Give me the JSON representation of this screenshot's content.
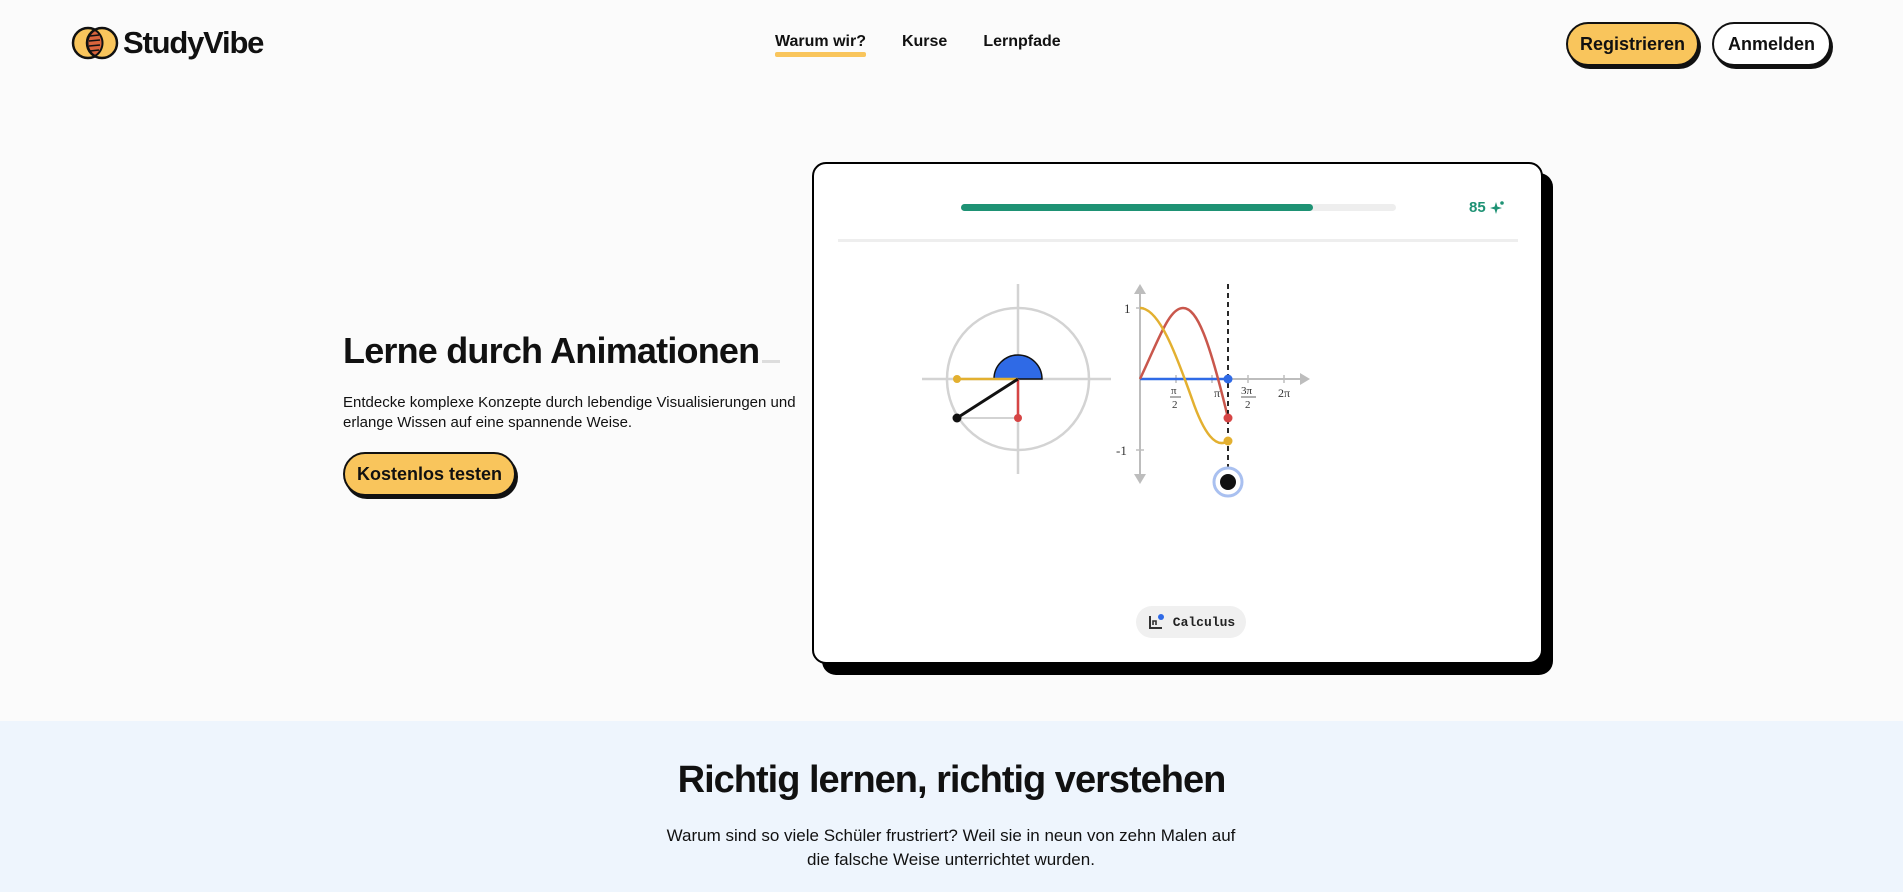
{
  "brand": {
    "name": "StudyVibe"
  },
  "nav": {
    "items": [
      {
        "label": "Warum wir?",
        "active": true
      },
      {
        "label": "Kurse",
        "active": false
      },
      {
        "label": "Lernpfade",
        "active": false
      }
    ]
  },
  "auth": {
    "register_label": "Registrieren",
    "login_label": "Anmelden"
  },
  "hero": {
    "title": "Lerne durch Animationen",
    "subtitle": "Entdecke komplexe Konzepte durch lebendige Visualisierungen und erlange Wissen auf eine spannende Weise.",
    "cta_label": "Kostenlos testen"
  },
  "demo": {
    "progress_percent": 81,
    "score": "85",
    "score_icon": "sparkle-icon",
    "axis_labels": {
      "y_top": "1",
      "y_bottom": "-1",
      "x_half_pi_num": "π",
      "x_half_pi_den": "2",
      "x_pi": "π",
      "x_three_half_pi_num": "3π",
      "x_three_half_pi_den": "2",
      "x_two_pi": "2π"
    },
    "chip_label": "Calculus",
    "chip_icon": "graph-icon"
  },
  "section2": {
    "title": "Richtig lernen, richtig verstehen",
    "text": "Warum sind so viele Schüler frustriert? Weil sie in neun von zehn Malen auf die falsche Weise unterrichtet wurden."
  },
  "colors": {
    "accent": "#f9c55c",
    "progress": "#1e9274",
    "blue": "#2f6ae6",
    "red": "#d64545",
    "yellow": "#e3b030",
    "section_bg": "#eef5fd"
  }
}
